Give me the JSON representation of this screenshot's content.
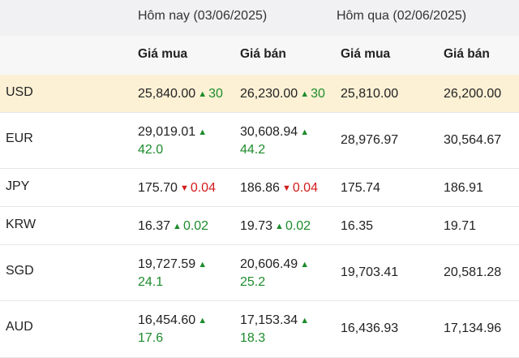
{
  "header": {
    "today": "Hôm nay (03/06/2025)",
    "yesterday": "Hôm qua (02/06/2025)",
    "buy": "Giá mua",
    "sell": "Giá bán"
  },
  "rows": [
    {
      "currency": "USD",
      "t_buy": "25,840.00",
      "t_buy_chg": "30",
      "t_buy_dir": "up",
      "t_sell": "26,230.00",
      "t_sell_chg": "30",
      "t_sell_dir": "up",
      "y_buy": "25,810.00",
      "y_sell": "26,200.00"
    },
    {
      "currency": "EUR",
      "t_buy": "29,019.01",
      "t_buy_chg": "42.0",
      "t_buy_dir": "up",
      "t_sell": "30,608.94",
      "t_sell_chg": "44.2",
      "t_sell_dir": "up",
      "y_buy": "28,976.97",
      "y_sell": "30,564.67"
    },
    {
      "currency": "JPY",
      "t_buy": "175.70",
      "t_buy_chg": "0.04",
      "t_buy_dir": "down",
      "t_sell": "186.86",
      "t_sell_chg": "0.04",
      "t_sell_dir": "down",
      "y_buy": "175.74",
      "y_sell": "186.91"
    },
    {
      "currency": "KRW",
      "t_buy": "16.37",
      "t_buy_chg": "0.02",
      "t_buy_dir": "up",
      "t_sell": "19.73",
      "t_sell_chg": "0.02",
      "t_sell_dir": "up",
      "y_buy": "16.35",
      "y_sell": "19.71"
    },
    {
      "currency": "SGD",
      "t_buy": "19,727.59",
      "t_buy_chg": "24.1",
      "t_buy_dir": "up",
      "t_sell": "20,606.49",
      "t_sell_chg": "25.2",
      "t_sell_dir": "up",
      "y_buy": "19,703.41",
      "y_sell": "20,581.28"
    },
    {
      "currency": "AUD",
      "t_buy": "16,454.60",
      "t_buy_chg": "17.6",
      "t_buy_dir": "up",
      "t_sell": "17,153.34",
      "t_sell_chg": "18.3",
      "t_sell_dir": "up",
      "y_buy": "16,436.93",
      "y_sell": "17,134.96"
    }
  ],
  "colors": {
    "up": "#1d8c2c",
    "down": "#d31b1b",
    "highlight": "#fcf1d5"
  },
  "icons": {
    "up": "triangle-up-icon",
    "down": "triangle-down-icon"
  }
}
